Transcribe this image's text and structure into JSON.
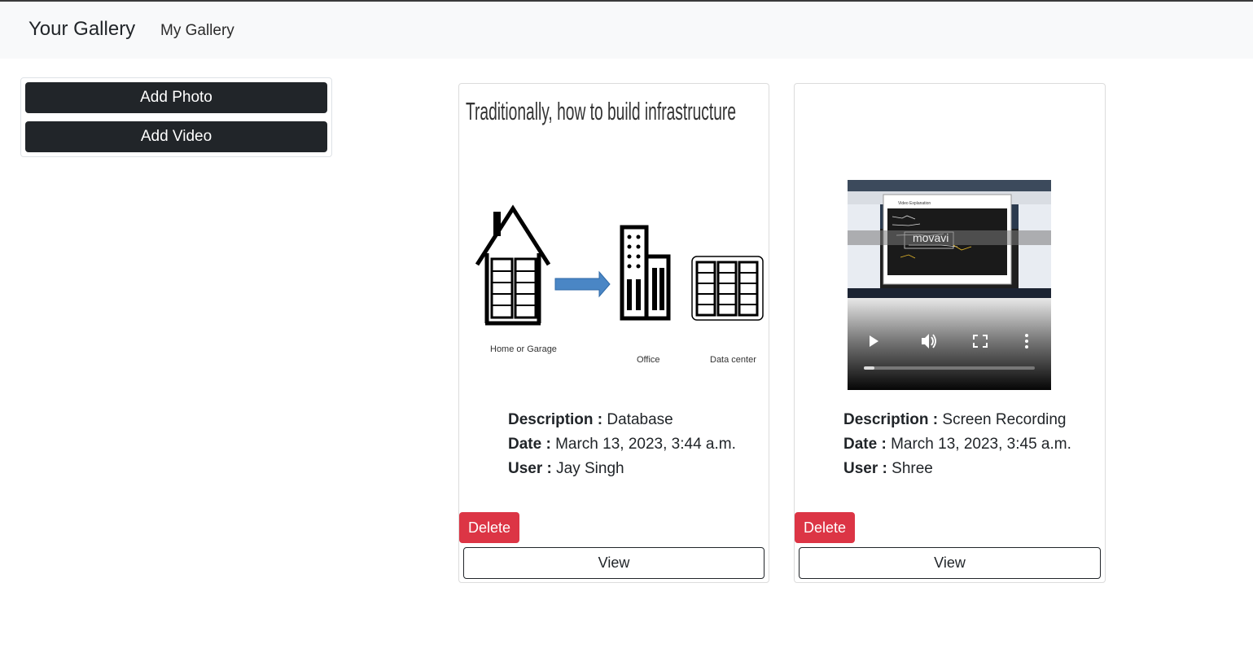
{
  "navbar": {
    "brand": "Your Gallery",
    "link": "My Gallery"
  },
  "sidebar": {
    "add_photo": "Add Photo",
    "add_video": "Add Video"
  },
  "cards": [
    {
      "image": {
        "title": "Traditionally, how to build infrastructure",
        "labels": [
          "Home or Garage",
          "Office",
          "Data center"
        ]
      },
      "description_label": "Description :",
      "description": "Database",
      "date_label": "Date :",
      "date": "March 13, 2023, 3:44 a.m.",
      "user_label": "User :",
      "user": "Jay Singh",
      "delete_label": "Delete",
      "view_label": "View"
    },
    {
      "video": {
        "watermark": "movavi",
        "dialog_title": "Video Explanation"
      },
      "description_label": "Description :",
      "description": "Screen Recording",
      "date_label": "Date :",
      "date": "March 13, 2023, 3:45 a.m.",
      "user_label": "User :",
      "user": "Shree",
      "delete_label": "Delete",
      "view_label": "View"
    }
  ],
  "colors": {
    "navbar_bg": "#f8f9fa",
    "dark_button": "#212529",
    "danger": "#dc3545",
    "arrow": "#4a86c5"
  }
}
